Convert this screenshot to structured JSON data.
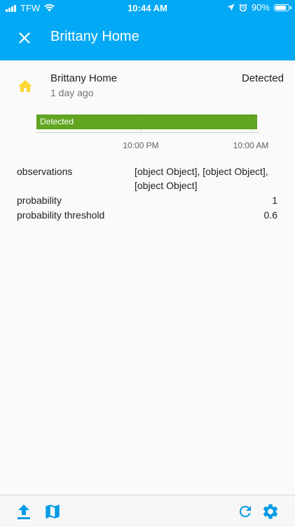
{
  "status_bar": {
    "carrier": "TFW",
    "time": "10:44 AM",
    "battery": "90%",
    "battery_level": 0.9,
    "icons": [
      "signal-icon",
      "wifi-icon",
      "location-arrow-icon",
      "alarm-icon",
      "battery-icon"
    ]
  },
  "header": {
    "title": "Brittany Home",
    "close_icon": "close-icon"
  },
  "entity": {
    "icon": "home-icon",
    "name": "Brittany Home",
    "last_changed": "1 day ago",
    "state": "Detected"
  },
  "timeline": {
    "bar_label": "Detected",
    "ticks": [
      "10:00 PM",
      "10:00 AM"
    ]
  },
  "attributes": [
    {
      "key": "observations",
      "value": "[object Object], [object Object], [object Object]"
    },
    {
      "key": "probability",
      "value": "1"
    },
    {
      "key": "probability threshold",
      "value": "0.6"
    }
  ],
  "toolbar": {
    "left_icons": [
      "upload-icon",
      "map-icon"
    ],
    "right_icons": [
      "refresh-icon",
      "settings-gear-icon"
    ]
  },
  "colors": {
    "header_bg": "#03a9f4",
    "timeline_bar": "#62a521",
    "icon_yellow": "#fdd835",
    "toolbar_icon_blue": "#039be5"
  }
}
